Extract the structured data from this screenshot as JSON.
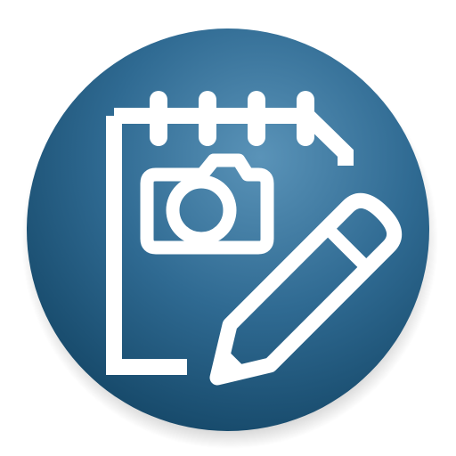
{
  "icon": {
    "name": "notepad-camera-pencil-icon",
    "glyphs": [
      "notepad-icon",
      "spiral-binding-icon",
      "camera-icon",
      "pencil-icon"
    ]
  },
  "colors": {
    "circle_light": "#5a93b8",
    "circle_mid": "#2f6a92",
    "circle_dark": "#174a6b",
    "glyph": "#ffffff"
  }
}
